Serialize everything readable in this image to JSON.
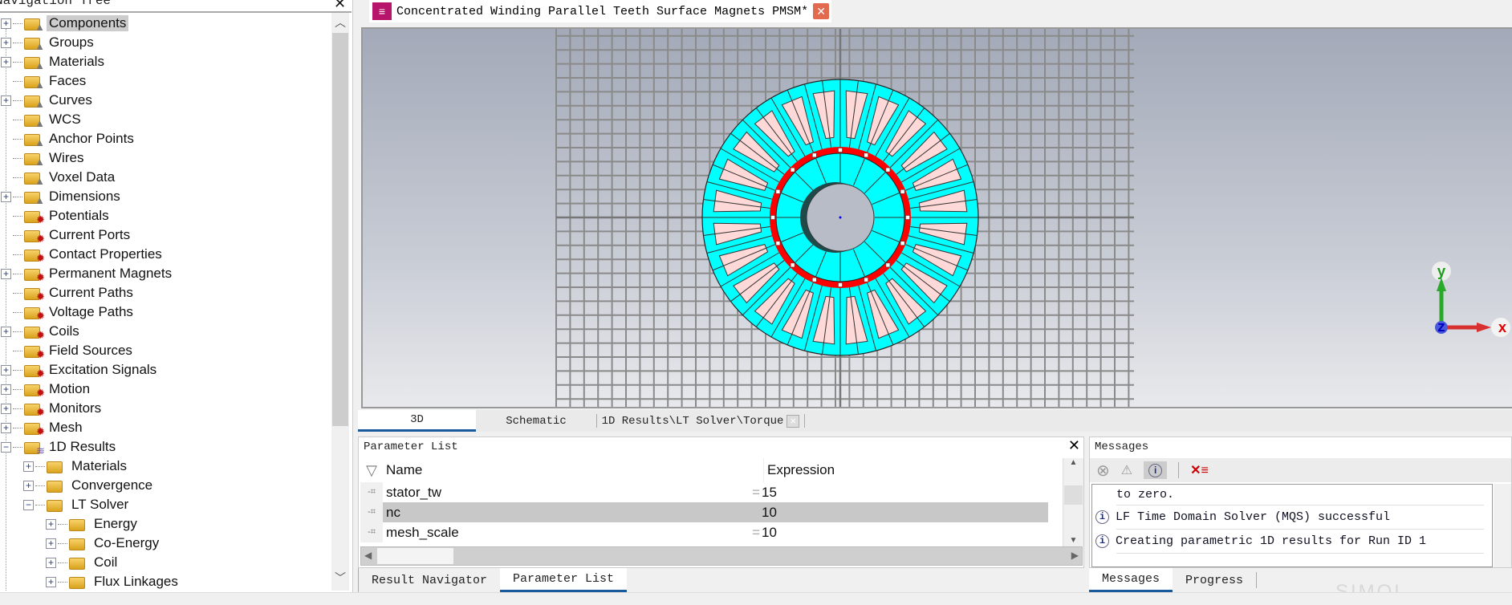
{
  "navigation": {
    "title": "Navigation Tree",
    "items": [
      {
        "label": "Components",
        "level": 0,
        "expander": "plus",
        "icon": "folder-shape",
        "selected": true
      },
      {
        "label": "Groups",
        "level": 0,
        "expander": "plus",
        "icon": "folder-shape"
      },
      {
        "label": "Materials",
        "level": 0,
        "expander": "plus",
        "icon": "folder-shape"
      },
      {
        "label": "Faces",
        "level": 0,
        "expander": "none",
        "icon": "folder-shape"
      },
      {
        "label": "Curves",
        "level": 0,
        "expander": "plus",
        "icon": "folder-shape"
      },
      {
        "label": "WCS",
        "level": 0,
        "expander": "none",
        "icon": "folder-shape"
      },
      {
        "label": "Anchor Points",
        "level": 0,
        "expander": "none",
        "icon": "folder-shape"
      },
      {
        "label": "Wires",
        "level": 0,
        "expander": "none",
        "icon": "folder-shape"
      },
      {
        "label": "Voxel Data",
        "level": 0,
        "expander": "none",
        "icon": "folder-shape"
      },
      {
        "label": "Dimensions",
        "level": 0,
        "expander": "plus",
        "icon": "folder-shape"
      },
      {
        "label": "Potentials",
        "level": 0,
        "expander": "none",
        "icon": "folder-gear"
      },
      {
        "label": "Current Ports",
        "level": 0,
        "expander": "none",
        "icon": "folder-gear"
      },
      {
        "label": "Contact Properties",
        "level": 0,
        "expander": "none",
        "icon": "folder-gear"
      },
      {
        "label": "Permanent Magnets",
        "level": 0,
        "expander": "plus",
        "icon": "folder-gear"
      },
      {
        "label": "Current Paths",
        "level": 0,
        "expander": "none",
        "icon": "folder-gear"
      },
      {
        "label": "Voltage Paths",
        "level": 0,
        "expander": "none",
        "icon": "folder-gear"
      },
      {
        "label": "Coils",
        "level": 0,
        "expander": "plus",
        "icon": "folder-gear"
      },
      {
        "label": "Field Sources",
        "level": 0,
        "expander": "none",
        "icon": "folder-gear"
      },
      {
        "label": "Excitation Signals",
        "level": 0,
        "expander": "plus",
        "icon": "folder-gear"
      },
      {
        "label": "Motion",
        "level": 0,
        "expander": "plus",
        "icon": "folder-gear"
      },
      {
        "label": "Monitors",
        "level": 0,
        "expander": "plus",
        "icon": "folder-gear"
      },
      {
        "label": "Mesh",
        "level": 0,
        "expander": "plus",
        "icon": "folder-gear"
      },
      {
        "label": "1D Results",
        "level": 0,
        "expander": "minus",
        "icon": "folder-wave"
      },
      {
        "label": "Materials",
        "level": 1,
        "expander": "plus",
        "icon": "folder"
      },
      {
        "label": "Convergence",
        "level": 1,
        "expander": "plus",
        "icon": "folder"
      },
      {
        "label": "LT Solver",
        "level": 1,
        "expander": "minus",
        "icon": "folder"
      },
      {
        "label": "Energy",
        "level": 2,
        "expander": "plus",
        "icon": "folder"
      },
      {
        "label": "Co-Energy",
        "level": 2,
        "expander": "plus",
        "icon": "folder"
      },
      {
        "label": "Coil",
        "level": 2,
        "expander": "plus",
        "icon": "folder"
      },
      {
        "label": "Flux Linkages",
        "level": 2,
        "expander": "plus",
        "icon": "folder"
      }
    ]
  },
  "document_tab": {
    "title": "Concentrated Winding Parallel Teeth Surface Magnets PMSM*",
    "icon": "cst-logo-icon"
  },
  "viewport": {
    "axes": {
      "x": "x",
      "y": "y",
      "z": "z"
    },
    "colors": {
      "stator": "#00ffff",
      "slots": "#ffd8d8",
      "magnets": "#ff0000",
      "grid": "#8a8a8a"
    }
  },
  "view_tabs": [
    {
      "label": "3D",
      "active": true
    },
    {
      "label": "Schematic",
      "active": false
    },
    {
      "label": "1D Results\\LT Solver\\Torque",
      "active": false,
      "closable": true
    }
  ],
  "parameter_list": {
    "title": "Parameter List",
    "columns": [
      "Name",
      "Expression"
    ],
    "rows": [
      {
        "name": "stator_tw",
        "expression": "15",
        "eq": "="
      },
      {
        "name": "nc",
        "expression": "10",
        "eq": "",
        "selected": true
      },
      {
        "name": "mesh_scale",
        "expression": "10",
        "eq": "="
      }
    ]
  },
  "left_bottom_tabs": [
    {
      "label": "Result Navigator",
      "active": false
    },
    {
      "label": "Parameter List",
      "active": true
    }
  ],
  "messages": {
    "title": "Messages",
    "lines": [
      {
        "text": "to zero.",
        "icon": false
      },
      {
        "text": "LF Time Domain Solver (MQS) successful",
        "icon": true
      },
      {
        "text": "Creating parametric 1D results for Run ID 1",
        "icon": true
      }
    ]
  },
  "right_bottom_tabs": [
    {
      "label": "Messages",
      "active": true
    },
    {
      "label": "Progress",
      "active": false
    }
  ],
  "watermark": "SIMOL 西莫"
}
